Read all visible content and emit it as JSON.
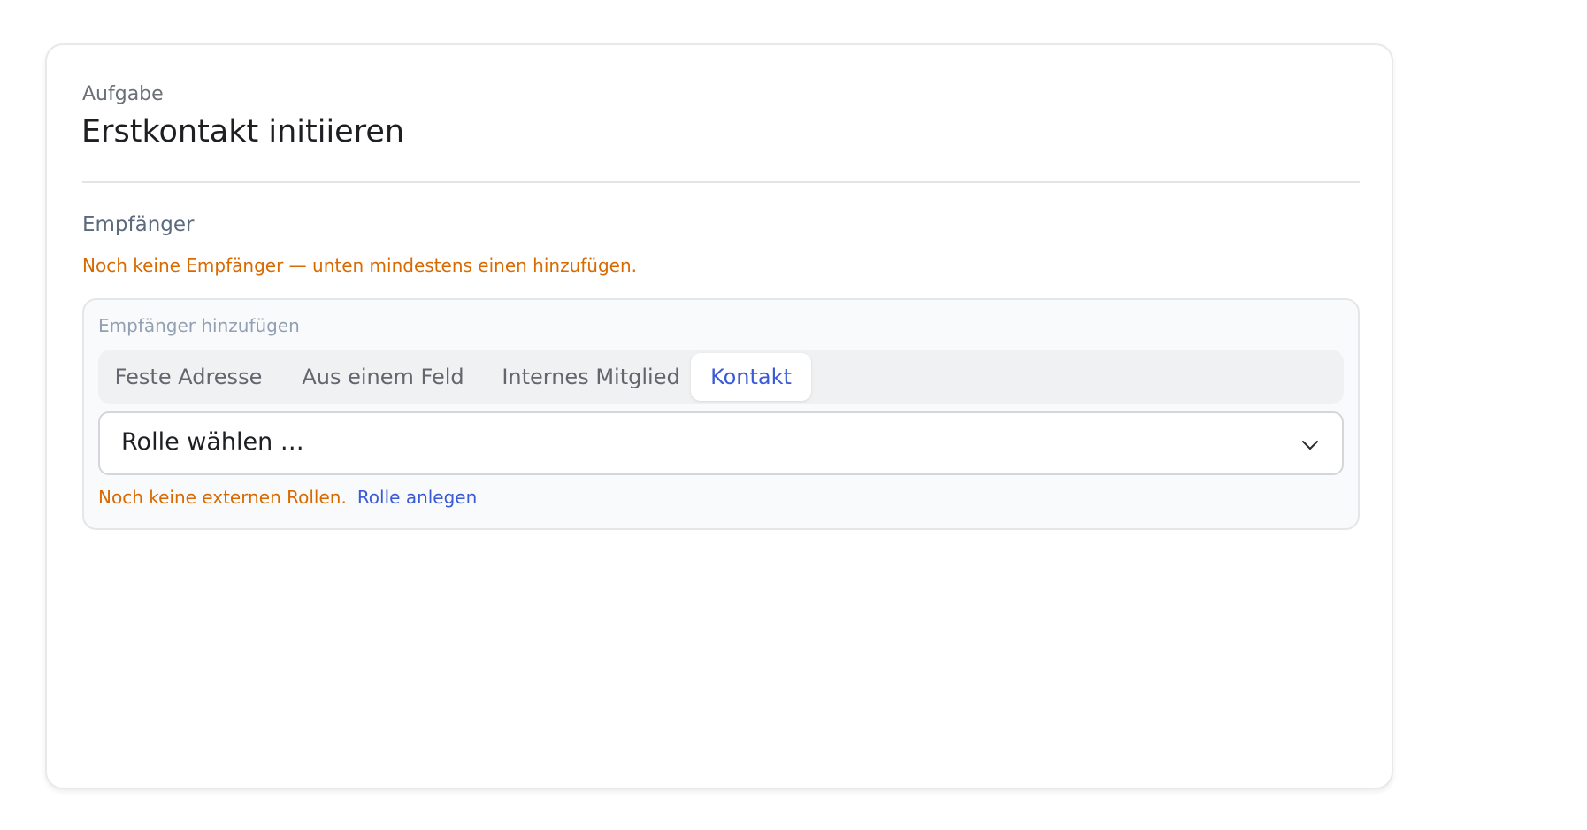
{
  "task": {
    "overline": "Aufgabe",
    "title": "Erstkontakt initiieren"
  },
  "recipients": {
    "label": "Empfänger",
    "empty_warning": "Noch keine Empfänger — unten mindestens einen hinzufügen."
  },
  "add_panel": {
    "label": "Empfänger hinzufügen",
    "tabs": [
      {
        "label": "Feste Adresse",
        "active": false
      },
      {
        "label": "Aus einem Feld",
        "active": false
      },
      {
        "label": "Internes Mitglied",
        "active": false
      },
      {
        "label": "Kontakt",
        "active": true
      }
    ],
    "role_select": {
      "value": "Rolle wählen …",
      "icon": "chevron-down-icon"
    },
    "hint": {
      "text": "Noch keine externen Rollen.",
      "link": "Rolle anlegen"
    }
  },
  "colors": {
    "accent": "#3b5bd6",
    "warning": "#d96a00",
    "text": "#1d1f23",
    "muted": "#6b6f76"
  }
}
